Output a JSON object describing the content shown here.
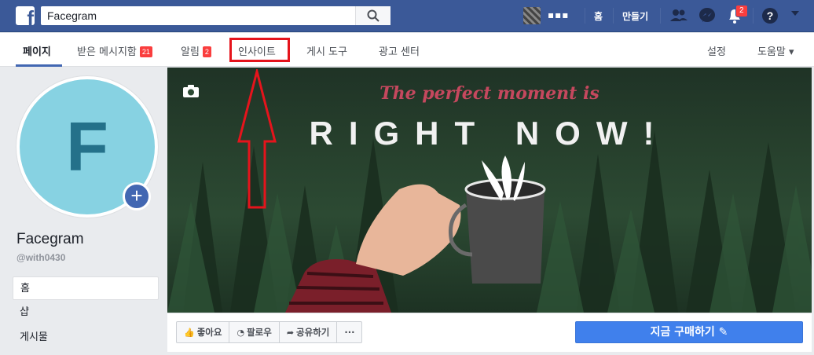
{
  "topbar": {
    "logo": "f",
    "search_value": "Facegram",
    "username": "▪▪▪",
    "home_label": "홈",
    "create_label": "만들기",
    "notifications_badge": "2",
    "icons": [
      "facebook-logo-icon",
      "search-icon",
      "friends-icon",
      "messenger-icon",
      "bell-icon",
      "help-icon"
    ]
  },
  "pagenav": {
    "items": [
      {
        "label": "페이지",
        "badge": ""
      },
      {
        "label": "받은 메시지함",
        "badge": "21"
      },
      {
        "label": "알림",
        "badge": "2"
      },
      {
        "label": "인사이트",
        "badge": ""
      },
      {
        "label": "게시 도구",
        "badge": ""
      },
      {
        "label": "광고 센터",
        "badge": ""
      }
    ],
    "settings_label": "설정",
    "help_label": "도움말 ▾"
  },
  "sidebar": {
    "profile_letter": "F",
    "add_icon": "+",
    "page_name": "Facegram",
    "handle": "@with0430",
    "items": [
      {
        "label": "홈"
      },
      {
        "label": "샵"
      },
      {
        "label": "게시물"
      }
    ]
  },
  "cover": {
    "tagline": "The perfect moment is",
    "headline": "RIGHT NOW!"
  },
  "actions": {
    "like": "좋아요",
    "follow": "팔로우",
    "share": "공유하기",
    "more": "···",
    "buy": "지금 구매하기 ✎"
  },
  "colors": {
    "brand": "#3b5998",
    "accent": "#4267b2",
    "highlight": "#e5141c",
    "badge": "#fa3e3e"
  }
}
